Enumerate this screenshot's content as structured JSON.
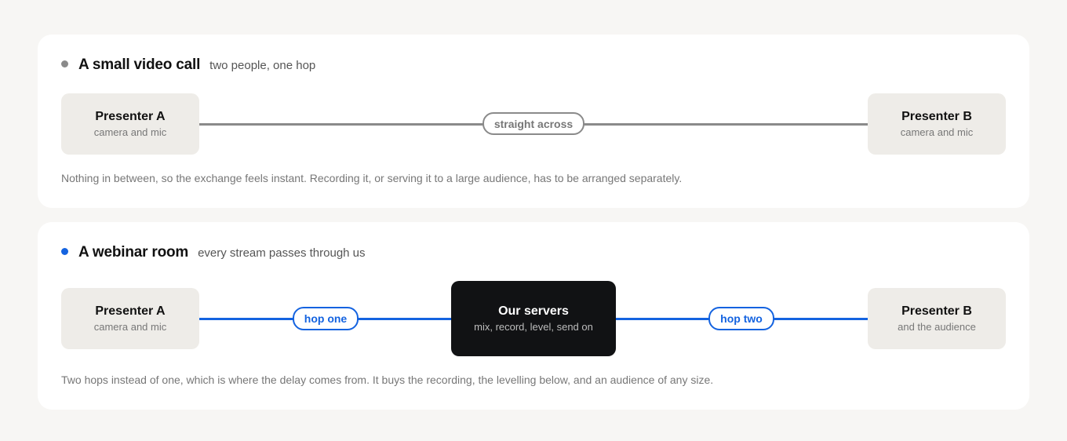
{
  "colors": {
    "gray": "#8a8a8a",
    "blue": "#1463e0"
  },
  "call": {
    "title": "A small video call",
    "subtitle": "two people, one hop",
    "left": {
      "title": "Presenter A",
      "sub": "camera and mic"
    },
    "right": {
      "title": "Presenter B",
      "sub": "camera and mic"
    },
    "link_label": "straight across",
    "note": "Nothing in between, so the exchange feels instant. Recording it, or serving it to a large audience, has to be arranged separately."
  },
  "webinar": {
    "title": "A webinar room",
    "subtitle": "every stream passes through us",
    "left": {
      "title": "Presenter A",
      "sub": "camera and mic"
    },
    "center": {
      "title": "Our servers",
      "sub": "mix, record, level, send on"
    },
    "right": {
      "title": "Presenter B",
      "sub": "and the audience"
    },
    "hop1_label": "hop one",
    "hop2_label": "hop two",
    "note": "Two hops instead of one, which is where the delay comes from. It buys the recording, the levelling below, and an audience of any size."
  }
}
